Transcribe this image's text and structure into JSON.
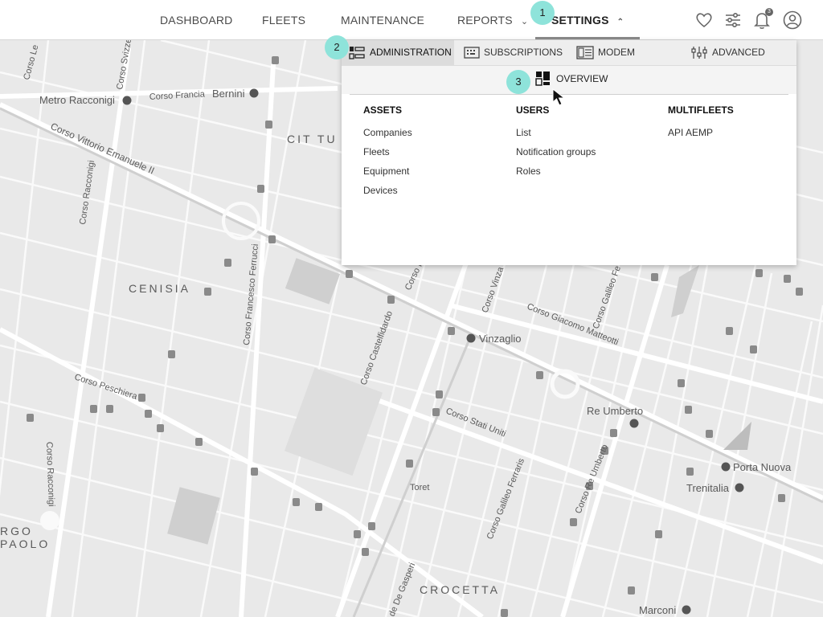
{
  "nav": {
    "items": [
      {
        "label": "DASHBOARD"
      },
      {
        "label": "FLEETS"
      },
      {
        "label": "MAINTENANCE"
      },
      {
        "label": "REPORTS"
      },
      {
        "label": "SETTINGS"
      }
    ],
    "notification_count": "3"
  },
  "steps": [
    "1",
    "2",
    "3"
  ],
  "panel": {
    "tabs": [
      {
        "label": "ADMINISTRATION",
        "icon": "list-icon"
      },
      {
        "label": "SUBSCRIPTIONS",
        "icon": "keyboard-icon"
      },
      {
        "label": "MODEM",
        "icon": "modem-icon"
      },
      {
        "label": "ADVANCED",
        "icon": "sliders-icon"
      }
    ],
    "overview_label": "OVERVIEW",
    "columns": [
      {
        "title": "ASSETS",
        "links": [
          "Companies",
          "Fleets",
          "Equipment",
          "Devices"
        ]
      },
      {
        "title": "USERS",
        "links": [
          "List",
          "Notification groups",
          "Roles"
        ]
      },
      {
        "title": "MULTIFLEETS",
        "links": [
          "API AEMP"
        ]
      }
    ]
  },
  "map": {
    "labels": {
      "metro_racconigi": "Metro Racconigi",
      "corso_francia": "Corso Francia",
      "bernini": "Bernini",
      "cit_tu": "CIT TU",
      "corso_vittorio": "Corso Vittorio Emanuele II",
      "corso_racconigi_1": "Corso Racconigi",
      "corso_racconigi_2": "Corso Racconigi",
      "cenisia": "CENISIA",
      "corso_ferrucci": "Corso Francesco Ferrucci",
      "corso_peschiera": "Corso Peschiera",
      "corso_castelfidardo": "Corso Castelfidardo",
      "vinzaglio": "Vinzaglio",
      "corso_giacomo": "Corso Giacomo Matteotti",
      "corso_stati_uniti": "Corso Stati Uniti",
      "re_umberto": "Re Umberto",
      "corso_re_umberto": "Corso Re Umberto",
      "corso_galileo": "Corso Galileo Ferraris",
      "porta_nuova": "Porta Nuova",
      "trenitalia": "Trenitalia",
      "toret": "Toret",
      "crocetta": "CROCETTA",
      "marconi": "Marconi",
      "rgo": "RGO",
      "paolo": "PAOLO",
      "corso_le": "Corso Le",
      "corso_svizzera": "Corso Svizze",
      "corso_in": "Corso In",
      "corso_vinza": "Corso Vinza",
      "corso_galileo_fe": "Corso Galileo Fe",
      "de_gasperi": "de De Gasperi"
    }
  }
}
